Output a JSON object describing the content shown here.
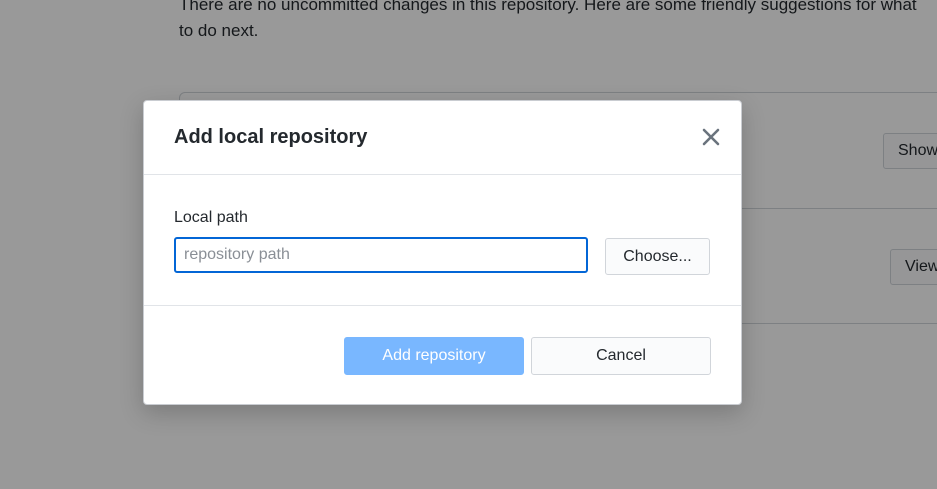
{
  "background": {
    "message": "There are no uncommitted changes in this repository. Here are some friendly suggestions for what to do next.",
    "show_button_label": "Show",
    "view_button_label": "View"
  },
  "dialog": {
    "title": "Add local repository",
    "close_icon": "close-icon",
    "local_path_label": "Local path",
    "path_input": {
      "value": "",
      "placeholder": "repository path"
    },
    "choose_button_label": "Choose...",
    "add_button_label": "Add repository",
    "add_button_disabled": true,
    "cancel_button_label": "Cancel"
  },
  "colors": {
    "accent": "#2188ff",
    "focus_border": "#0366d6"
  }
}
